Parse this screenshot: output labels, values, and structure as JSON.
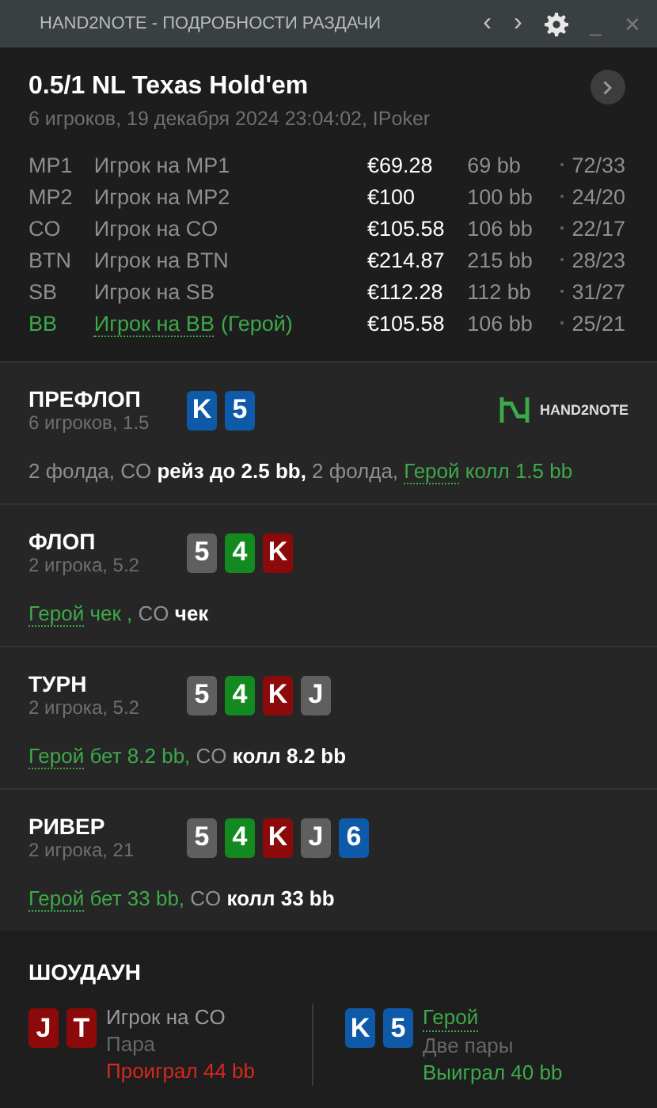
{
  "window": {
    "title": "HAND2NOTE - ПОДРОБНОСТИ РАЗДАЧИ",
    "controls": [
      "‹",
      "›",
      "_",
      "✕"
    ]
  },
  "hand": {
    "title": "0.5/1 NL Texas Hold'em",
    "subtitle": "6 игроков, 19 декабря 2024 23:04:02, IPoker",
    "players": [
      {
        "position": "MP1",
        "name": "Игрок на MP1",
        "hero": false,
        "stack": "€69.28",
        "bb": "69 bb",
        "stats": "72/33"
      },
      {
        "position": "MP2",
        "name": "Игрок на MP2",
        "hero": false,
        "stack": "€100",
        "bb": "100 bb",
        "stats": "24/20"
      },
      {
        "position": "CO",
        "name": "Игрок на CO",
        "hero": false,
        "stack": "€105.58",
        "bb": "106 bb",
        "stats": "22/17"
      },
      {
        "position": "BTN",
        "name": "Игрок на BTN",
        "hero": false,
        "stack": "€214.87",
        "bb": "215 bb",
        "stats": "28/23"
      },
      {
        "position": "SB",
        "name": "Игрок на SB",
        "hero": false,
        "stack": "€112.28",
        "bb": "112 bb",
        "stats": "31/27"
      },
      {
        "position": "BB",
        "name": "Игрок на BB",
        "hero": true,
        "hero_tag": "(Герой)",
        "stack": "€105.58",
        "bb": "106 bb",
        "stats": "25/21"
      }
    ]
  },
  "streets": [
    {
      "name": "ПРЕФЛОП",
      "info": "6 игроков, 1.5",
      "logo": "HAND2NOTE",
      "cards": [
        {
          "rank": "K",
          "color": "#0f5aa8"
        },
        {
          "rank": "5",
          "color": "#0f5aa8"
        }
      ],
      "actions": [
        {
          "text": "2 фолда, CO ",
          "kind": "muted"
        },
        {
          "text": "рейз до 2.5 bb,",
          "kind": "bold"
        },
        {
          "text": " 2 фолда, ",
          "kind": "muted"
        },
        {
          "text": "Герой",
          "kind": "hero_link"
        },
        {
          "text": " колл 1.5 bb",
          "kind": "hero"
        }
      ]
    },
    {
      "name": "ФЛОП",
      "info": "2 игрока, 5.2",
      "cards": [
        {
          "rank": "5",
          "color": "#5f5f5f"
        },
        {
          "rank": "4",
          "color": "#138a1f"
        },
        {
          "rank": "K",
          "color": "#8c0a0a"
        }
      ],
      "actions": [
        {
          "text": "Герой",
          "kind": "hero_link"
        },
        {
          "text": " чек ,",
          "kind": "hero"
        },
        {
          "text": " CO ",
          "kind": "muted"
        },
        {
          "text": "чек",
          "kind": "bold"
        }
      ]
    },
    {
      "name": "ТУРН",
      "info": "2 игрока, 5.2",
      "cards": [
        {
          "rank": "5",
          "color": "#5f5f5f"
        },
        {
          "rank": "4",
          "color": "#138a1f"
        },
        {
          "rank": "K",
          "color": "#8c0a0a"
        },
        {
          "rank": "J",
          "color": "#5f5f5f"
        }
      ],
      "actions": [
        {
          "text": "Герой",
          "kind": "hero_link"
        },
        {
          "text": " бет 8.2 bb,",
          "kind": "hero"
        },
        {
          "text": " CO ",
          "kind": "muted"
        },
        {
          "text": "колл 8.2 bb",
          "kind": "bold"
        }
      ]
    },
    {
      "name": "РИВЕР",
      "info": "2 игрока, 21",
      "cards": [
        {
          "rank": "5",
          "color": "#5f5f5f"
        },
        {
          "rank": "4",
          "color": "#138a1f"
        },
        {
          "rank": "K",
          "color": "#8c0a0a"
        },
        {
          "rank": "J",
          "color": "#5f5f5f"
        },
        {
          "rank": "6",
          "color": "#0f5aa8"
        }
      ],
      "actions": [
        {
          "text": "Герой",
          "kind": "hero_link"
        },
        {
          "text": " бет 33 bb,",
          "kind": "hero"
        },
        {
          "text": " CO ",
          "kind": "muted"
        },
        {
          "text": "колл 33 bb",
          "kind": "bold"
        }
      ]
    }
  ],
  "showdown": {
    "title": "ШОУДАУН",
    "players": [
      {
        "name": "Игрок на CO",
        "hero": false,
        "hand": "Пара",
        "result": "Проиграл 44 bb",
        "won": false,
        "cards": [
          {
            "rank": "J",
            "color": "#8c0a0a"
          },
          {
            "rank": "T",
            "color": "#8c0a0a"
          }
        ]
      },
      {
        "name": "Герой",
        "hero": true,
        "hand": "Две пары",
        "result": "Выиграл 40 bb",
        "won": true,
        "cards": [
          {
            "rank": "K",
            "color": "#0f5aa8"
          },
          {
            "rank": "5",
            "color": "#0f5aa8"
          }
        ]
      }
    ]
  }
}
